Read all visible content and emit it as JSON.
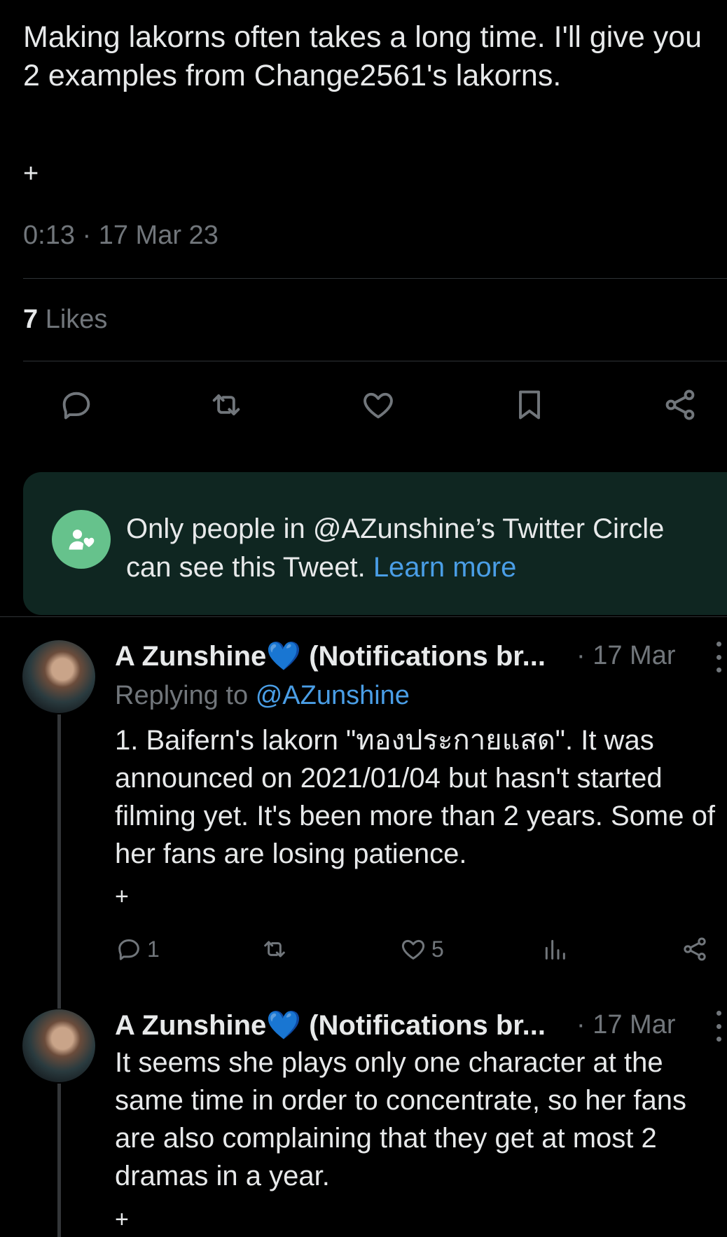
{
  "tweet": {
    "text": "Making lakorns often takes a long time. I'll give you 2 examples from Change2561's lakorns.",
    "plus": "+",
    "meta": "0:13 · 17 Mar 23",
    "likes_count": "7",
    "likes_label": "Likes"
  },
  "actions": [
    "reply-icon",
    "retweet-icon",
    "like-icon",
    "bookmark-icon",
    "share-icon"
  ],
  "circle_notice": {
    "text": "Only people in @AZunshine’s Twitter Circle can see this Tweet.",
    "link": "Learn more"
  },
  "replies": [
    {
      "name": "A Zunshine💙 (Notifications br...",
      "date": "· 17 Mar",
      "replying_prefix": "Replying to",
      "replying_handle": "@AZunshine",
      "text": "1. Baifern's lakorn \"ทองประกายแสด\". It was announced on 2021/01/04 but hasn't started filming yet. It's been more than 2 years. Some of her fans are losing patience.",
      "plus": "+",
      "reply_count": "1",
      "like_count": "5"
    },
    {
      "name": "A Zunshine💙 (Notifications br...",
      "date": "· 17 Mar",
      "text": "It seems she plays only one character at the same time in order to concentrate, so her fans are also complaining that they get at most 2 dramas in a year.",
      "plus": "+"
    }
  ],
  "colors": {
    "background": "#000000",
    "text": "#e7e9ea",
    "muted": "#71767b",
    "link": "#4a9ee6",
    "circle_bg": "#0f2621",
    "circle_icon": "#66c28c"
  }
}
